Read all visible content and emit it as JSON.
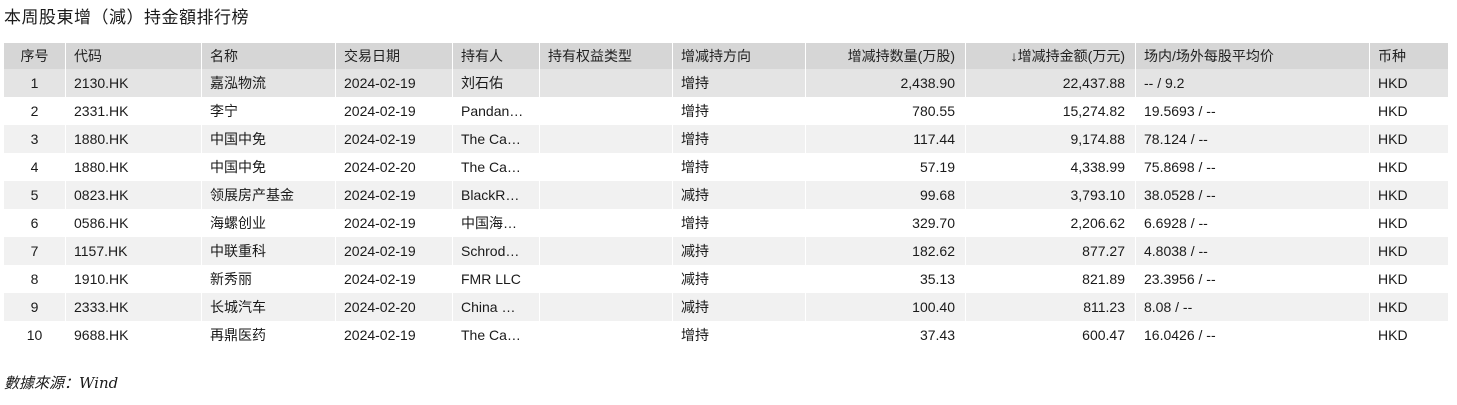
{
  "title": "本周股東增（減）持金額排行榜",
  "source_note": "數據來源：Wind",
  "table": {
    "headers": {
      "index": "序号",
      "code": "代码",
      "name": "名称",
      "date": "交易日期",
      "holder": "持有人",
      "equity_type": "持有权益类型",
      "direction": "增减持方向",
      "quantity": "增减持数量(万股)",
      "amount": "↓增减持金额(万元)",
      "avg_price": "场内/场外每股平均价",
      "currency": "币种"
    },
    "sort_column": "amount",
    "rows": [
      {
        "index": "1",
        "code": "2130.HK",
        "name": "嘉泓物流",
        "date": "2024-02-19",
        "holder": "刘石佑",
        "equity_type": "",
        "direction": "增持",
        "quantity": "2,438.90",
        "amount": "22,437.88",
        "avg_price": "-- / 9.2",
        "currency": "HKD"
      },
      {
        "index": "2",
        "code": "2331.HK",
        "name": "李宁",
        "date": "2024-02-19",
        "holder": "Pandan…",
        "equity_type": "",
        "direction": "增持",
        "quantity": "780.55",
        "amount": "15,274.82",
        "avg_price": "19.5693 / --",
        "currency": "HKD"
      },
      {
        "index": "3",
        "code": "1880.HK",
        "name": "中国中免",
        "date": "2024-02-19",
        "holder": "The Ca…",
        "equity_type": "",
        "direction": "增持",
        "quantity": "117.44",
        "amount": "9,174.88",
        "avg_price": "78.124 / --",
        "currency": "HKD"
      },
      {
        "index": "4",
        "code": "1880.HK",
        "name": "中国中免",
        "date": "2024-02-20",
        "holder": "The Ca…",
        "equity_type": "",
        "direction": "增持",
        "quantity": "57.19",
        "amount": "4,338.99",
        "avg_price": "75.8698 / --",
        "currency": "HKD"
      },
      {
        "index": "5",
        "code": "0823.HK",
        "name": "领展房产基金",
        "date": "2024-02-19",
        "holder": "BlackR…",
        "equity_type": "",
        "direction": "减持",
        "quantity": "99.68",
        "amount": "3,793.10",
        "avg_price": "38.0528 / --",
        "currency": "HKD"
      },
      {
        "index": "6",
        "code": "0586.HK",
        "name": "海螺创业",
        "date": "2024-02-19",
        "holder": "中国海…",
        "equity_type": "",
        "direction": "增持",
        "quantity": "329.70",
        "amount": "2,206.62",
        "avg_price": "6.6928 / --",
        "currency": "HKD"
      },
      {
        "index": "7",
        "code": "1157.HK",
        "name": "中联重科",
        "date": "2024-02-19",
        "holder": "Schrod…",
        "equity_type": "",
        "direction": "减持",
        "quantity": "182.62",
        "amount": "877.27",
        "avg_price": "4.8038 / --",
        "currency": "HKD"
      },
      {
        "index": "8",
        "code": "1910.HK",
        "name": "新秀丽",
        "date": "2024-02-19",
        "holder": "FMR LLC",
        "equity_type": "",
        "direction": "减持",
        "quantity": "35.13",
        "amount": "821.89",
        "avg_price": "23.3956 / --",
        "currency": "HKD"
      },
      {
        "index": "9",
        "code": "2333.HK",
        "name": "长城汽车",
        "date": "2024-02-20",
        "holder": "China …",
        "equity_type": "",
        "direction": "减持",
        "quantity": "100.40",
        "amount": "811.23",
        "avg_price": "8.08 / --",
        "currency": "HKD"
      },
      {
        "index": "10",
        "code": "9688.HK",
        "name": "再鼎医药",
        "date": "2024-02-19",
        "holder": "The Ca…",
        "equity_type": "",
        "direction": "增持",
        "quantity": "37.43",
        "amount": "600.47",
        "avg_price": "16.0426 / --",
        "currency": "HKD"
      }
    ]
  }
}
